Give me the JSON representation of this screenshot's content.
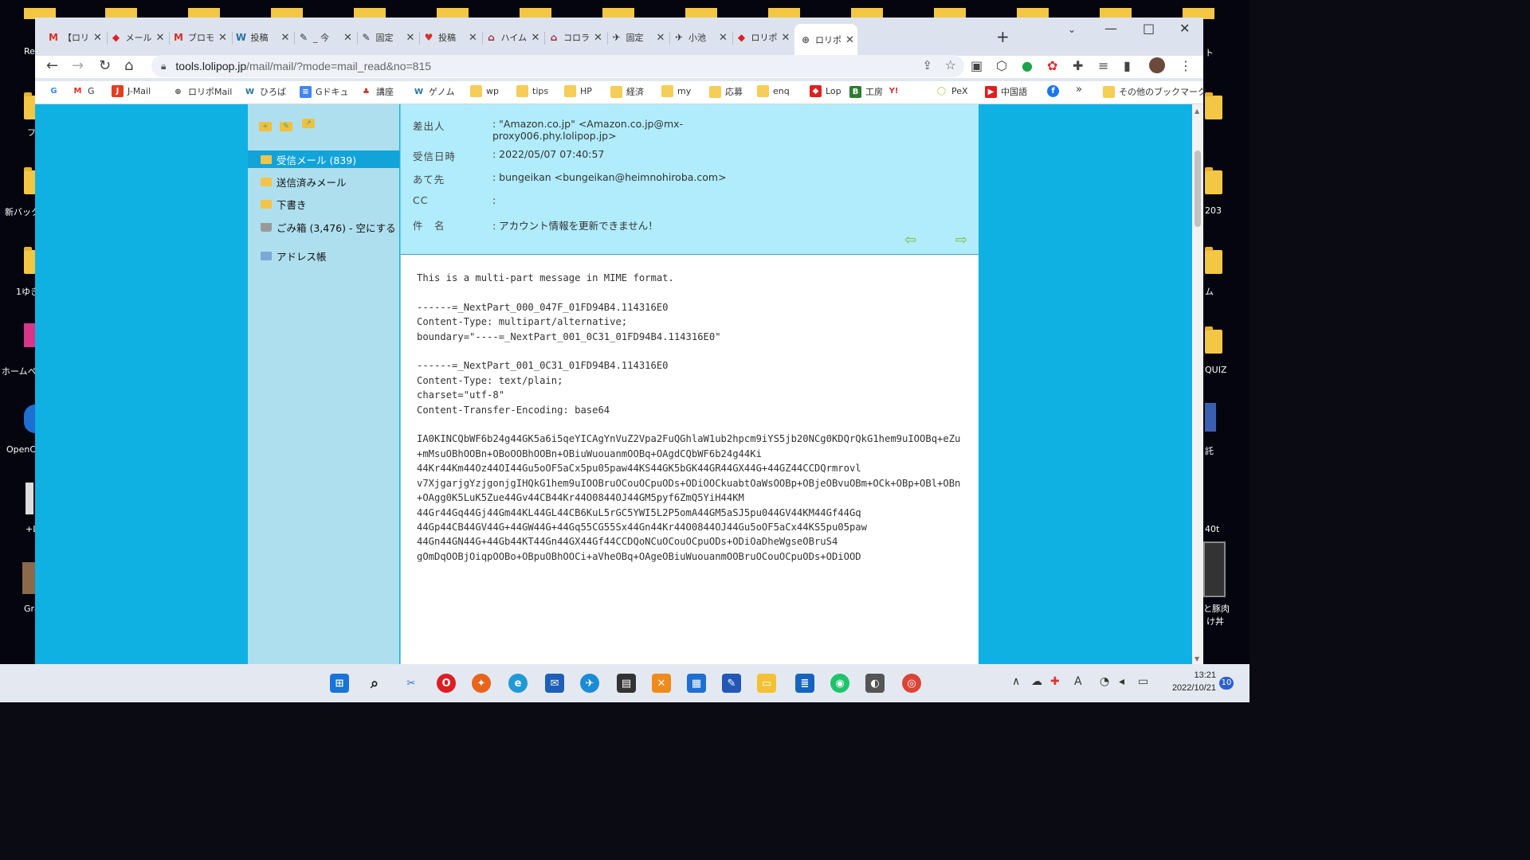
{
  "desktop": {
    "left_labels": [
      "Re",
      "フ",
      "新バック",
      "1ゆき",
      "ホームペー",
      "OpenC",
      "+L",
      "Gra"
    ],
    "right_labels": [
      "ト",
      "203",
      "ム",
      "QUIZ",
      "託",
      "40t",
      "と豚肉",
      "け丼"
    ]
  },
  "browser": {
    "tabs": [
      {
        "icon": "M",
        "title": "【ロリ",
        "color": "#d93025"
      },
      {
        "icon": "◆",
        "title": "メール",
        "color": "#e02020"
      },
      {
        "icon": "M",
        "title": "ブロモ",
        "color": "#d93025"
      },
      {
        "icon": "W",
        "title": "投稿",
        "color": "#21759b"
      },
      {
        "icon": "✎",
        "title": "_ 今",
        "color": "#333333"
      },
      {
        "icon": "✎",
        "title": "固定",
        "color": "#333333"
      },
      {
        "icon": "♥",
        "title": "投稿",
        "color": "#d93025"
      },
      {
        "icon": "⌂",
        "title": "ハイム",
        "color": "#a0203a"
      },
      {
        "icon": "⌂",
        "title": "コロラ",
        "color": "#a0203a"
      },
      {
        "icon": "✈",
        "title": "固定",
        "color": "#333333"
      },
      {
        "icon": "✈",
        "title": "小池",
        "color": "#333333"
      },
      {
        "icon": "◆",
        "title": "ロリポ",
        "color": "#e02020"
      },
      {
        "icon": "⊕",
        "title": "ロリポ",
        "color": "#555555",
        "active": true
      }
    ],
    "address": {
      "host": "tools.lolipop.jp",
      "path": "/mail/mail/?mode=mail_read&no=815"
    },
    "bookmarks": [
      {
        "icon": "G",
        "label": "",
        "type": "google"
      },
      {
        "icon": "M",
        "label": "G",
        "type": "gmail"
      },
      {
        "icon": "J",
        "label": "J-Mail",
        "type": "jcom"
      },
      {
        "icon": "⊕",
        "label": "ロリポMail",
        "type": "globe"
      },
      {
        "icon": "W",
        "label": "ひろば",
        "type": "wp"
      },
      {
        "icon": "≡",
        "label": "Gドキュ",
        "type": "doc"
      },
      {
        "icon": "♣",
        "label": "講座",
        "type": "red"
      },
      {
        "icon": "W",
        "label": "ゲノム",
        "type": "wp"
      },
      {
        "icon": "",
        "label": "wp",
        "type": "folder"
      },
      {
        "icon": "",
        "label": "tips",
        "type": "folder"
      },
      {
        "icon": "",
        "label": "HP",
        "type": "folder"
      },
      {
        "icon": "",
        "label": "経済",
        "type": "folder"
      },
      {
        "icon": "",
        "label": "my",
        "type": "folder"
      },
      {
        "icon": "",
        "label": "応募",
        "type": "folder"
      },
      {
        "icon": "",
        "label": "enq",
        "type": "folder"
      },
      {
        "icon": "◆",
        "label": "Lop",
        "type": "lolipop"
      },
      {
        "icon": "B",
        "label": "工房",
        "type": "b"
      },
      {
        "icon": "Y!",
        "label": "",
        "type": "yahoo"
      },
      {
        "icon": "◯",
        "label": "PeX",
        "type": "pex"
      },
      {
        "icon": "▶",
        "label": "中国語",
        "type": "youtube"
      },
      {
        "icon": "f",
        "label": "",
        "type": "facebook"
      }
    ],
    "bookmarks_more": "»",
    "other_bookmarks": "その他のブックマーク"
  },
  "mail": {
    "sidebar": {
      "folders": [
        {
          "label": "受信メール (839)",
          "selected": true
        },
        {
          "label": "送信済みメール"
        },
        {
          "label": "下書き"
        },
        {
          "label": "ごみ箱 (3,476)  -  空にする"
        }
      ],
      "addressbook": "アドレス帳"
    },
    "header": {
      "from_label": "差出人",
      "from_value": ": \"Amazon.co.jp\" <Amazon.co.jp@mx-proxy006.phy.lolipop.jp>",
      "date_label": "受信日時",
      "date_value": ": 2022/05/07 07:40:57",
      "to_label": "あて先",
      "to_value": ": bungeikan <bungeikan@heimnohiroba.com>",
      "cc_label": "CC",
      "cc_value": ":",
      "subject_label": "件　名",
      "subject_value": ": アカウント情報を更新できません！"
    },
    "body": "This is a multi-part message in MIME format.\n\n------=_NextPart_000_047F_01FD94B4.114316E0\nContent-Type: multipart/alternative;\nboundary=\"----=_NextPart_001_0C31_01FD94B4.114316E0\"\n\n------=_NextPart_001_0C31_01FD94B4.114316E0\nContent-Type: text/plain;\ncharset=\"utf-8\"\nContent-Transfer-Encoding: base64\n\nIA0KINCQbWF6b24g44GK5a6i5qeYICAgYnVuZ2Vpa2FuQGhlaW1ub2hpcm9iYS5jb20NCg0KDQrQkG1hem9uIOOBq+eZu+mMsuOBhOOBn+OBoOOBhOOBn+OBiuWuouanmOOBq+OAgdCQbWF6b24g44Ki\n44Kr44Km44Oz44OI44Gu5oOF5aCx5pu05paw44KS44GK5bGK44GR44GX44G+44GZ44CCDQrmrovl\nv7XjgarjgYzjgonjgIHQkG1hem9uIOOBruOCouOCpuODs+ODiOOCkuabtOaWsOOBp+OBjeOBvuOBm+OCk+OBp+OBl+OBn+OAgg0K5LuK5Zue44Gv44CB44Kr44O0844OJ44GM5pyf6ZmQ5YiH44KM\n44Gr44Gq44Gj44Gm44KL44GL44CB6KuL5rGC5YWI5L2P5omA44GM5aSJ5pu044GV44KM44Gf44Gq\n44Gp44CB44GV44G+44GW44G+44Gq55CG55Sx44Gn44Kr44O0844OJ44Gu5oOF5aCx44KS5pu05paw\n44Gn44GN44G+44Gb44KT44Gn44GX44Gf44CCDQoNCuOCouOCpuODs+ODiOaDheWgseOBruS4\ngOmDqOOBjOiqpOOBo+OBpuOBhOOCi+aVheOBq+OAgeOBiuWuouanmOOBruOCouOCpuODs+ODiOOD"
  },
  "taskbar": {
    "time": "13:21",
    "date": "2022/10/21",
    "notifications": "10"
  }
}
